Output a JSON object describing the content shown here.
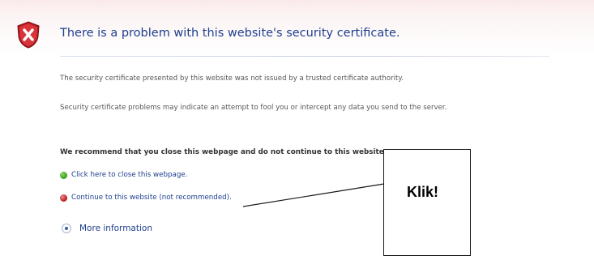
{
  "error_page": {
    "title": "There is a problem with this website's security certificate.",
    "paragraph1": "The security certificate presented by this website was not issued by a trusted certificate authority.",
    "paragraph2": "Security certificate problems may indicate an attempt to fool you or intercept any data you send to the server.",
    "recommendation": "We recommend that you close this webpage and do not continue to this website.",
    "close_link": "Click here to close this webpage.",
    "continue_link": "Continue to this website (not recommended).",
    "more_info": "More information"
  },
  "callout": {
    "text": "Klik!"
  },
  "icons": {
    "shield": "red-shield-x-icon",
    "close_link_icon": "green-shield-icon",
    "continue_link_icon": "red-shield-icon",
    "more_info_icon": "expand-circle-icon"
  },
  "colors": {
    "link": "#1f3f8f",
    "title": "#1f3f8f",
    "error_red": "#c81e25"
  }
}
